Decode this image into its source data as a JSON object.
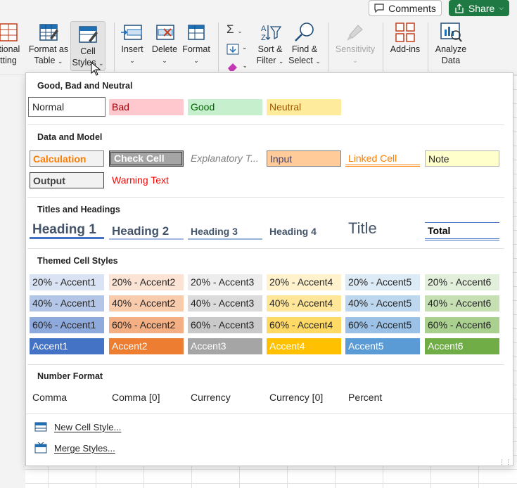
{
  "top": {
    "comments_label": "Comments",
    "share_label": "Share"
  },
  "ribbon": {
    "conditional_label_1": "itional",
    "conditional_label_2": "tting",
    "format_as_table_1": "Format as",
    "format_as_table_2": "Table",
    "cell_styles_1": "Cell",
    "cell_styles_2": "Styles",
    "insert": "Insert",
    "delete": "Delete",
    "format": "Format",
    "sort_filter_1": "Sort &",
    "sort_filter_2": "Filter",
    "find_select_1": "Find &",
    "find_select_2": "Select",
    "sensitivity": "Sensitivity",
    "addins": "Add-ins",
    "analyze_1": "Analyze",
    "analyze_2": "Data"
  },
  "panel": {
    "sections": {
      "good_bad": "Good, Bad and Neutral",
      "data_model": "Data and Model",
      "titles": "Titles and Headings",
      "themed": "Themed Cell Styles",
      "number": "Number Format"
    },
    "good_bad": [
      "Normal",
      "Bad",
      "Good",
      "Neutral"
    ],
    "data_model": [
      "Calculation",
      "Check Cell",
      "Explanatory T...",
      "Input",
      "Linked Cell",
      "Note",
      "Output",
      "Warning Text"
    ],
    "titles": [
      "Heading 1",
      "Heading 2",
      "Heading 3",
      "Heading 4",
      "Title",
      "Total"
    ],
    "themed": {
      "row20": [
        "20% - Accent1",
        "20% - Accent2",
        "20% - Accent3",
        "20% - Accent4",
        "20% - Accent5",
        "20% - Accent6"
      ],
      "row40": [
        "40% - Accent1",
        "40% - Accent2",
        "40% - Accent3",
        "40% - Accent4",
        "40% - Accent5",
        "40% - Accent6"
      ],
      "row60": [
        "60% - Accent1",
        "60% - Accent2",
        "60% - Accent3",
        "60% - Accent4",
        "60% - Accent5",
        "60% - Accent6"
      ],
      "accent": [
        "Accent1",
        "Accent2",
        "Accent3",
        "Accent4",
        "Accent5",
        "Accent6"
      ]
    },
    "number": [
      "Comma",
      "Comma [0]",
      "Currency",
      "Currency [0]",
      "Percent"
    ],
    "menu": {
      "new_cell_style": "New Cell Style...",
      "merge_styles": "Merge Styles..."
    }
  },
  "colors": {
    "share_green": "#1e7a42",
    "accent1": "#4472c4",
    "accent2": "#ed7d31",
    "accent3": "#a5a5a5",
    "accent4": "#ffc000",
    "accent5": "#5b9bd5",
    "accent6": "#70ad47"
  }
}
